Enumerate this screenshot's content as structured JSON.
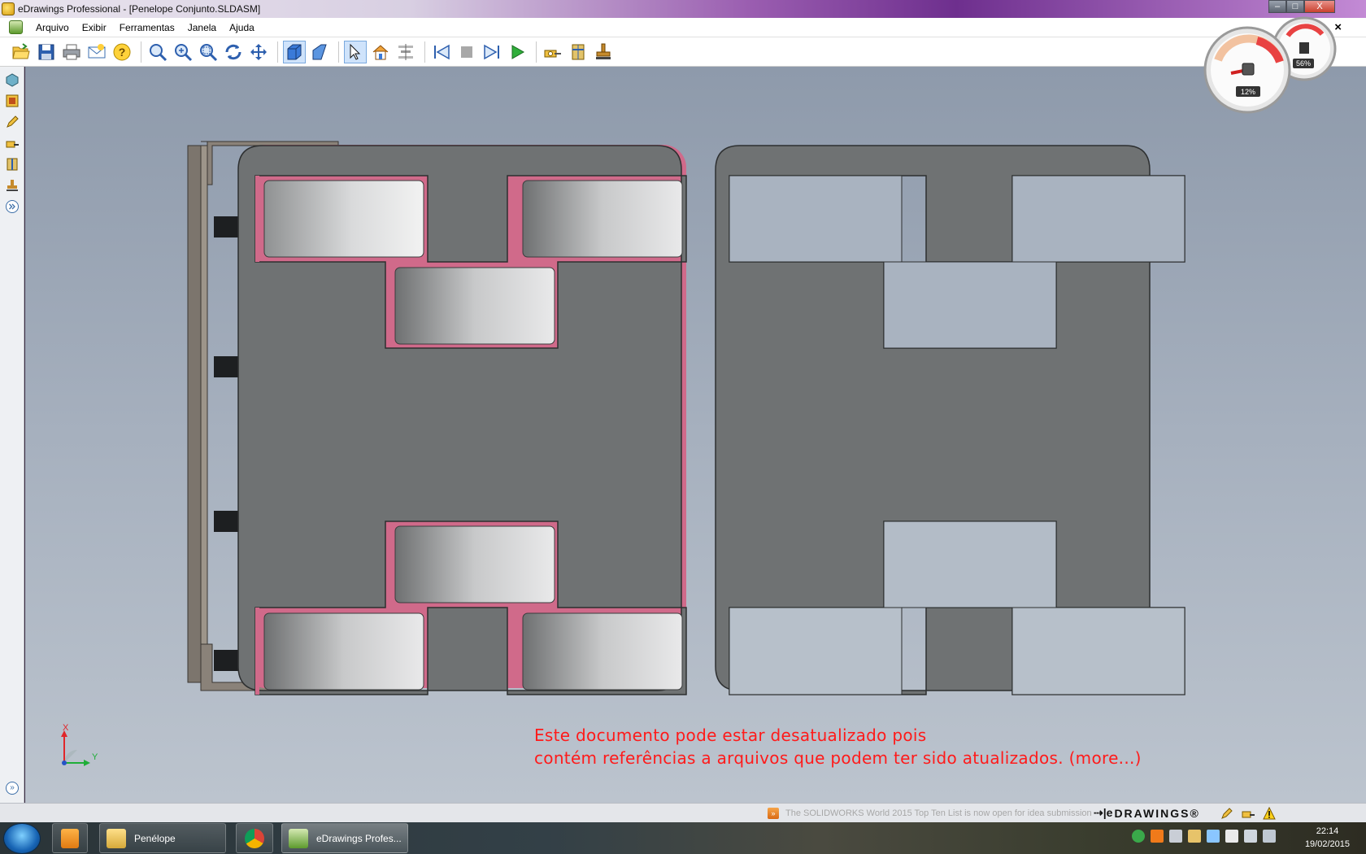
{
  "window": {
    "title": "eDrawings Professional - [Penelope Conjunto.SLDASM]",
    "controls": {
      "minimize": "–",
      "maximize": "□",
      "close": "X"
    }
  },
  "menubar": {
    "items": [
      "Arquivo",
      "Exibir",
      "Ferramentas",
      "Janela",
      "Ajuda"
    ],
    "doc_close": "×"
  },
  "toolbar": {
    "buttons": [
      "open-icon",
      "save-icon",
      "print-icon",
      "email-icon",
      "help-icon",
      "zoom-to-fit-icon",
      "zoom-in-icon",
      "zoom-area-icon",
      "rotate-icon",
      "pan-icon",
      "shaded-icon",
      "perspective-icon",
      "select-icon",
      "home-icon",
      "explode-icon",
      "first-frame-icon",
      "stop-icon",
      "next-frame-icon",
      "play-icon",
      "measure-icon",
      "section-icon",
      "stamp-icon"
    ],
    "active": [
      "shaded-icon",
      "select-icon"
    ]
  },
  "viewport": {
    "warning_line1": "Este documento pode estar desatualizado pois",
    "warning_line2": "contém referências a arquivos que podem ter sido atualizados.",
    "warning_more": "(more...)",
    "triad_x": "X",
    "triad_y": "Y"
  },
  "gadget": {
    "cpu_percent": 12,
    "memory_percent": 56,
    "cpu_label": "12%",
    "memory_label": "56%"
  },
  "statusbar": {
    "news": "The SOLIDWORKS World 2015 Top Ten List is now open for idea submission",
    "brand": "DRAWINGS®",
    "brand_prefix": "⇢|e"
  },
  "taskbar": {
    "items": [
      {
        "label": "Penélope",
        "active": false
      },
      {
        "label": "eDrawings Profes...",
        "active": true
      }
    ],
    "time": "22:14",
    "date": "19/02/2015"
  },
  "colors": {
    "viewport_top": "#8e9aab",
    "part_gray": "#6f7273",
    "warning_red": "#ff1a1a",
    "highlight_pink": "#d06a8a"
  }
}
